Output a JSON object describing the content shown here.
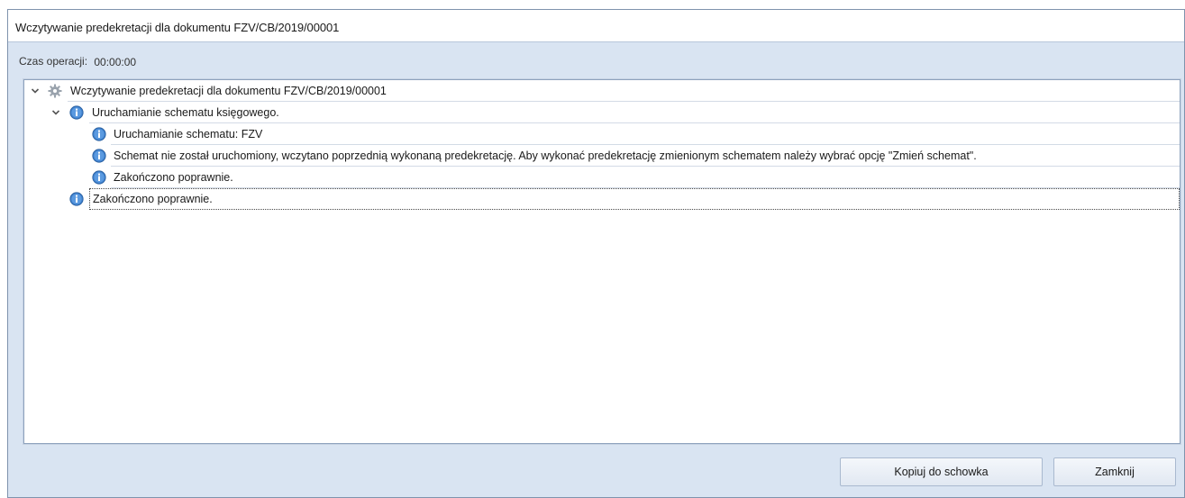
{
  "window": {
    "title": "Wczytywanie predekretacji dla dokumentu FZV/CB/2019/00001",
    "op_time_label": "Czas operacji:",
    "op_time_value": "00:00:00"
  },
  "tree": {
    "root_label": "Wczytywanie predekretacji dla dokumentu FZV/CB/2019/00001",
    "node1_label": "Uruchamianie schematu księgowego.",
    "node1_child1": "Uruchamianie schematu: FZV",
    "node1_child2": "Schemat nie został uruchomiony, wczytano poprzednią wykonaną predekretację.  Aby wykonać predekretację zmienionym schematem należy wybrać opcję \"Zmień schemat\".",
    "node1_child3": "Zakończono poprawnie.",
    "node2_label": "Zakończono poprawnie."
  },
  "buttons": {
    "copy": "Kopiuj do schowka",
    "close": "Zamknij"
  },
  "icons": {
    "root": "gear-icon",
    "info": "info-icon",
    "expand": "chevron-down-icon"
  },
  "colors": {
    "info_blue": "#3d7fcc",
    "window_bg": "#d9e4f2"
  }
}
